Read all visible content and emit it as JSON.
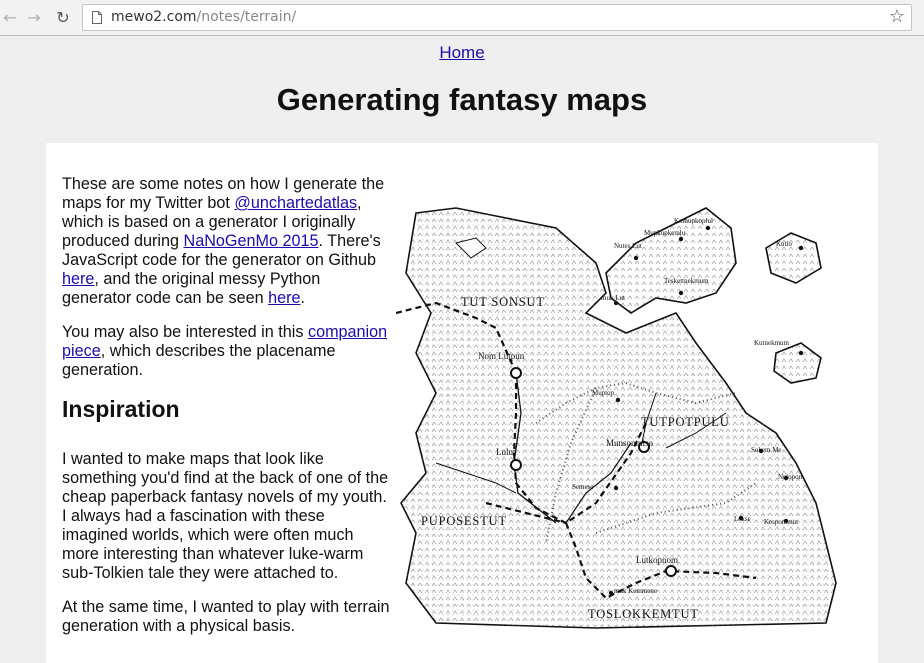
{
  "browser": {
    "url_host": "mewo2.com",
    "url_path": "/notes/terrain/",
    "back_icon": "arrow-left-icon",
    "forward_icon": "arrow-right-icon",
    "reload_icon": "reload-icon",
    "bookmark_icon": "star-icon"
  },
  "page": {
    "home_link": "Home",
    "title": "Generating fantasy maps"
  },
  "article": {
    "p1": {
      "t1": "These are some notes on how I generate the maps for my Twitter bot ",
      "link1": "@unchartedatlas",
      "t2": ", which is based on a generator I originally produced during ",
      "link2": "NaNoGenMo 2015",
      "t3": ". There's JavaScript code for the generator on Github ",
      "link3": "here",
      "t4": ", and the original messy Python generator code can be seen ",
      "link4": "here",
      "t5": "."
    },
    "p2": {
      "t1": "You may also be interested in this ",
      "link1": "companion piece",
      "t2": ", which describes the placename generation."
    },
    "heading": "Inspiration",
    "p3": "I wanted to make maps that look like something you'd find at the back of one of the cheap paperback fantasy novels of my youth. I always had a fascination with these imagined worlds, which were often much more interesting than whatever luke-warm sub-Tolkien tale they were attached to.",
    "p4": "At the same time, I wanted to play with terrain generation with a physical basis."
  },
  "map": {
    "regions": [
      "TUT SONSUT",
      "TUTPOTPULU",
      "PUPOSESTUT",
      "TOSLOKKEMTUT"
    ],
    "cities": [
      "Nom Lutpun",
      "Lulut",
      "Munsontulso",
      "Lutkopnom"
    ],
    "towns": [
      "Komupkoplul",
      "Mupkupkemlu",
      "Nutes Lut",
      "Kutlo",
      "Teskettnekmum",
      "muk Lut",
      "Kutnekmum",
      "Muptop",
      "Sokem Me",
      "Nelopon",
      "Semese",
      "Lekse",
      "Kesponmun",
      "muk Kemmene"
    ]
  }
}
